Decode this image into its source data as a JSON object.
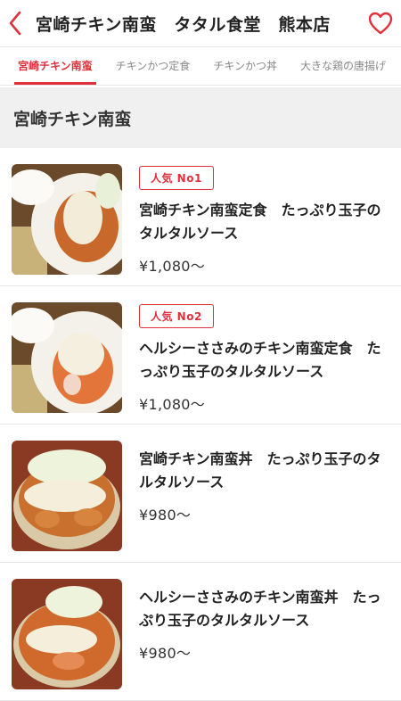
{
  "header": {
    "title": "宮崎チキン南蛮　タタル食堂　熊本店",
    "back_icon": "chevron-left-icon",
    "favorite_icon": "heart-outline-icon",
    "accent_color": "#e0313c"
  },
  "tabs": [
    {
      "label": "宮崎チキン南蛮",
      "active": true
    },
    {
      "label": "チキンかつ定食",
      "active": false
    },
    {
      "label": "チキンかつ丼",
      "active": false
    },
    {
      "label": "大きな鶏の唐揚げ",
      "active": false
    }
  ],
  "section": {
    "title": "宮崎チキン南蛮"
  },
  "items": [
    {
      "badge": "人気 No1",
      "name": "宮崎チキン南蛮定食　たっぷり玉子のタルタルソース",
      "price": "¥1,080〜"
    },
    {
      "badge": "人気 No2",
      "name": "ヘルシーささみのチキン南蛮定食　たっぷり玉子のタルタルソース",
      "price": "¥1,080〜"
    },
    {
      "badge": "",
      "name": "宮崎チキン南蛮丼　たっぷり玉子のタルタルソース",
      "price": "¥980〜"
    },
    {
      "badge": "",
      "name": "ヘルシーささみのチキン南蛮丼　たっぷり玉子のタルタルソース",
      "price": "¥980〜"
    }
  ]
}
